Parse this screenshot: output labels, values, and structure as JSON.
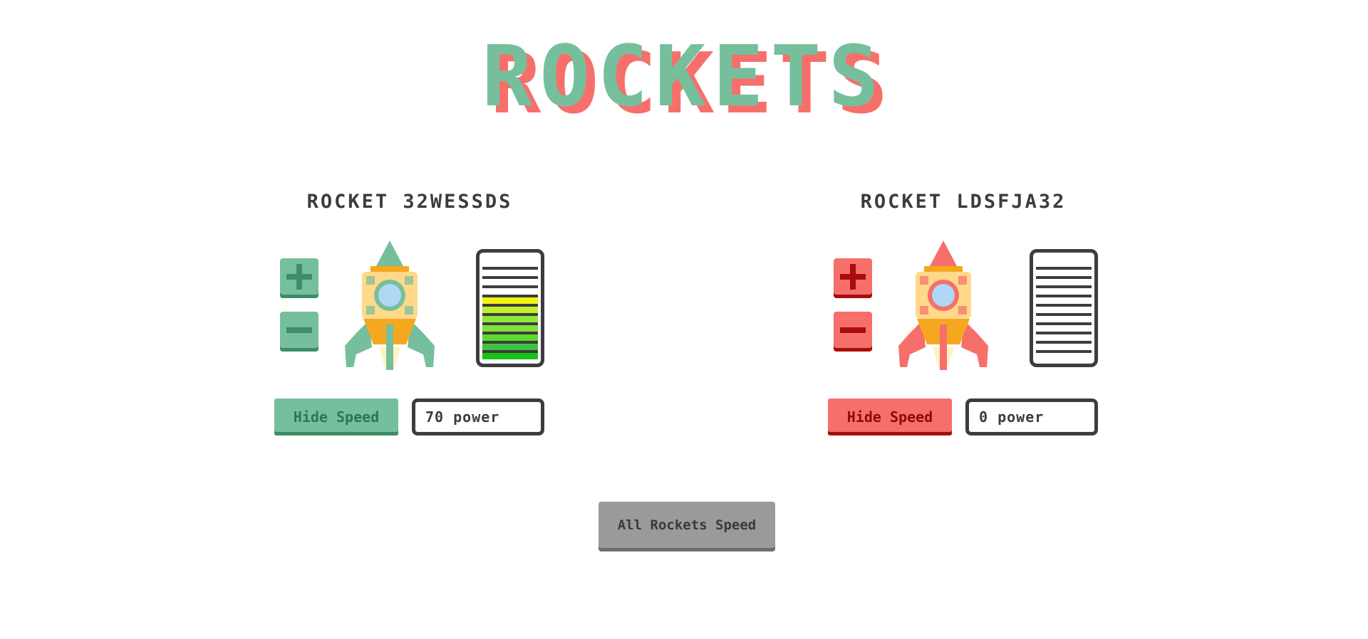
{
  "title": "ROCKETS",
  "colors": {
    "green": "#76bf9c",
    "green_dark": "#3f8c68",
    "red": "#f76f6b",
    "red_dark": "#a80d0d",
    "outline": "#3d3d3d",
    "gray_button": "#9a9a9a"
  },
  "rockets": [
    {
      "name": "ROCKET 32WESSDS",
      "theme": "green",
      "plus_icon": "plus-icon",
      "minus_icon": "minus-icon",
      "hide_label": "Hide Speed",
      "power_text": "70 power",
      "speed_level": 0.7
    },
    {
      "name": "ROCKET LDSFJA32",
      "theme": "red",
      "plus_icon": "plus-icon",
      "minus_icon": "minus-icon",
      "hide_label": "Hide Speed",
      "power_text": "0 power",
      "speed_level": 0
    }
  ],
  "all_rockets_button": "All Rockets Speed"
}
